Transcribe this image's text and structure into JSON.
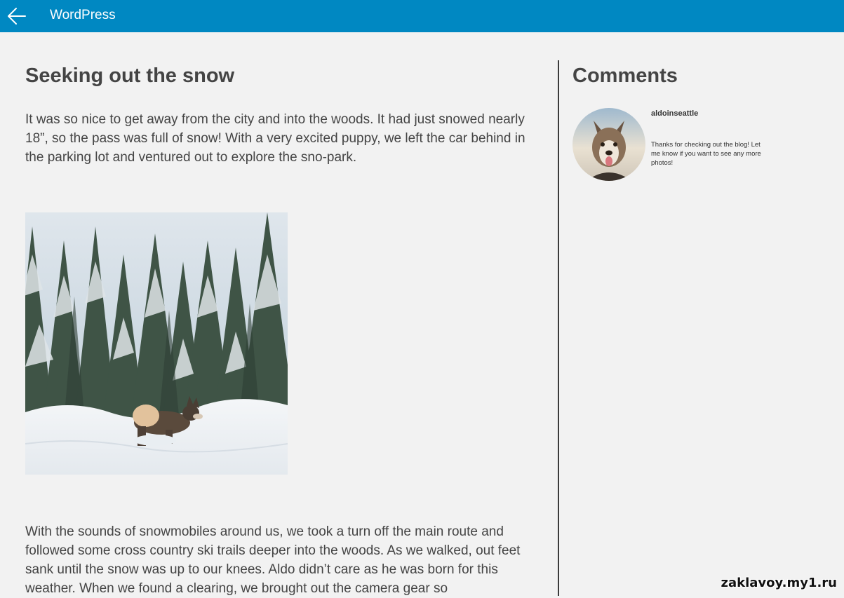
{
  "titlebar": {
    "app_title": "WordPress",
    "back_icon": "arrow-left-icon",
    "color": "#0088c2"
  },
  "post": {
    "title": "Seeking out the snow",
    "paragraph1": "It was so nice to get away from the city and into the woods.  It had just snowed nearly 18”, so the pass was full of snow!  With a very excited puppy, we left the car behind in the parking lot and ventured out to explore the sno-park.",
    "image_alt": "Dog running through snow in front of snow-covered evergreen trees",
    "paragraph2": "With the sounds of snowmobiles around us, we took a turn off the main route and followed some cross country ski trails deeper into the woods.  As we walked, out feet sank until the snow was up to our knees.  Aldo didn’t care as he was born for this weather.  When we found a clearing, we brought out the camera gear so"
  },
  "sidebar": {
    "title": "Comments",
    "comments": [
      {
        "author": "aldoinseattle",
        "text": "Thanks for checking out the blog! Let me know if you want to see any more photos!"
      }
    ]
  },
  "watermark": "zaklavoy.my1.ru"
}
